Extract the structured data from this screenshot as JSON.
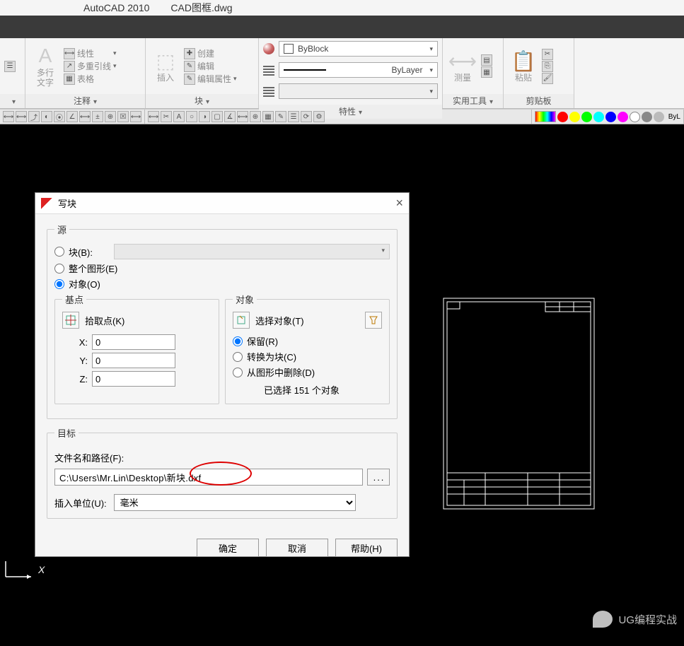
{
  "title": {
    "app": "AutoCAD 2010",
    "file": "CAD图框.dwg"
  },
  "ribbon": {
    "annotate": {
      "mtext": "多行\n文字",
      "line": "线性",
      "mleader": "多重引线",
      "table": "表格",
      "title": "注释"
    },
    "block": {
      "insert": "插入",
      "create": "创建",
      "edit": "编辑",
      "editattr": "编辑属性",
      "title": "块"
    },
    "props": {
      "byblock": "ByBlock",
      "bylayer": "ByLayer",
      "title": "特性"
    },
    "utility": {
      "measure": "测量",
      "title": "实用工具"
    },
    "clipboard": {
      "paste": "粘贴",
      "title": "剪贴板"
    }
  },
  "colors": [
    "#ff0000",
    "#ffff00",
    "#00ff00",
    "#00ffff",
    "#0000ff",
    "#ff00ff",
    "#ffffff",
    "#888888",
    "#bbbbbb"
  ],
  "byl": "ByL",
  "dialog": {
    "title": "写块",
    "source": {
      "legend": "源",
      "block": "块(B):",
      "entire": "整个图形(E)",
      "objects": "对象(O)",
      "basept": {
        "legend": "基点",
        "pick": "拾取点(K)",
        "x": "X:",
        "y": "Y:",
        "z": "Z:",
        "xv": "0",
        "yv": "0",
        "zv": "0"
      },
      "objs": {
        "legend": "对象",
        "select": "选择对象(T)",
        "retain": "保留(R)",
        "convert": "转换为块(C)",
        "delete": "从图形中删除(D)",
        "status": "已选择 151 个对象"
      }
    },
    "target": {
      "legend": "目标",
      "pathlabel": "文件名和路径(F):",
      "path": "C:\\Users\\Mr.Lin\\Desktop\\新块.dxf",
      "unitlabel": "插入单位(U):",
      "unit": "毫米"
    },
    "buttons": {
      "ok": "确定",
      "cancel": "取消",
      "help": "帮助(H)"
    }
  },
  "wechat": "UG编程实战"
}
